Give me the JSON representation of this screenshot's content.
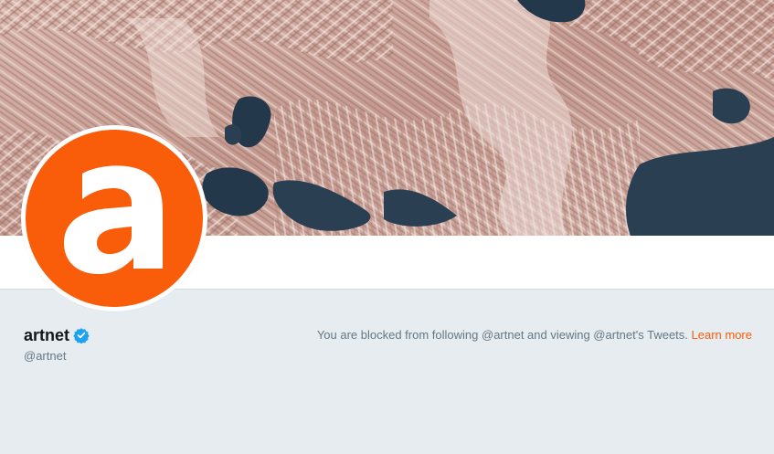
{
  "banner": {
    "alt": "artnet header photo"
  },
  "profile": {
    "name": "artnet",
    "handle": "@artnet",
    "verified": true,
    "avatar_letter": "a",
    "avatar_color": "#f95d0a"
  },
  "blocked": {
    "message": "You are blocked from following @artnet and viewing @artnet's Tweets.",
    "link_label": "Learn more",
    "link_color": "#f95d0a"
  },
  "colors": {
    "page_bg": "#e6ecf0",
    "verified_blue": "#1da1f2",
    "text_primary": "#14171a",
    "text_secondary": "#657786"
  }
}
